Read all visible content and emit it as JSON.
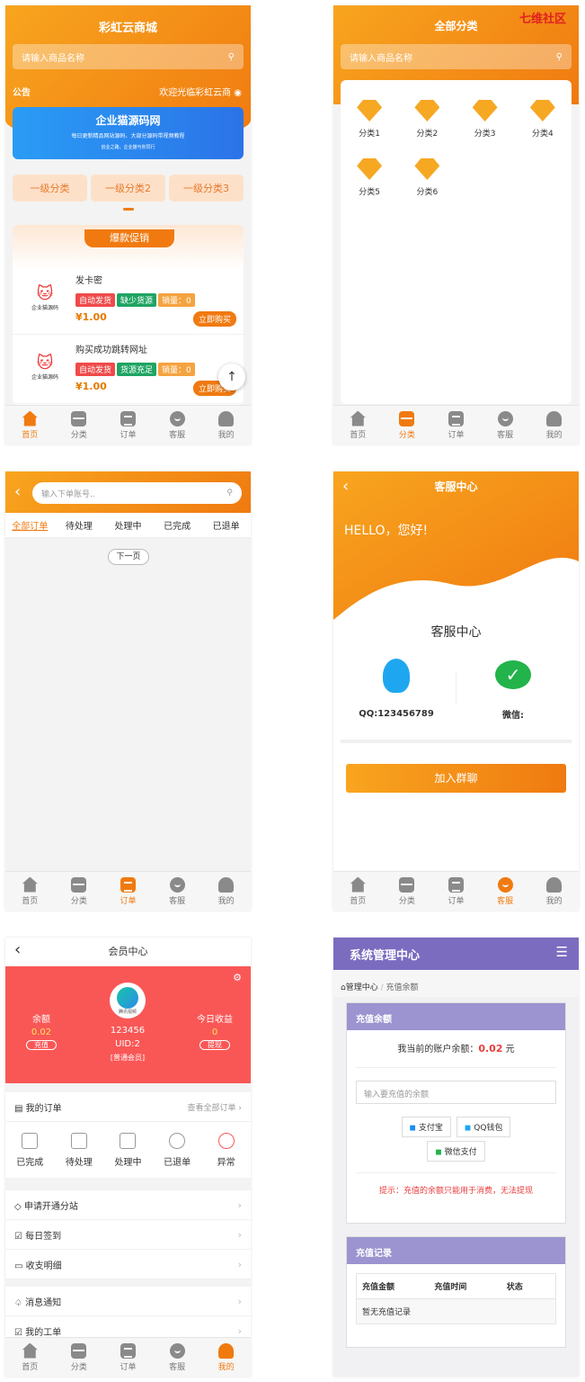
{
  "shop": {
    "title": "彩虹云商城",
    "search_placeholder": "请输入商品名称",
    "notice_label": "公告",
    "welcome": "欢迎光临彩虹云商",
    "banner_title": "企业猫源码网",
    "banner_sub": "每日更新精品网站源码、大部分源码带视频教程",
    "banner_sub2": "创业之路，企业猫与你同行",
    "subcats": [
      "一级分类",
      "一级分类2",
      "一级分类3"
    ],
    "hot_title": "爆款促销",
    "logo_text": "企业猫源码",
    "products": [
      {
        "name": "发卡密",
        "tags": [
          "自动发货",
          "缺少货源",
          "销量：0"
        ],
        "price": "¥1.00",
        "buy": "立即购买"
      },
      {
        "name": "购买成功跳转网址",
        "tags": [
          "自动发货",
          "货源充足",
          "销量：0"
        ],
        "price": "¥1.00",
        "buy": "立即购买"
      }
    ],
    "back_top": "↑"
  },
  "categories": {
    "title": "全部分类",
    "watermark": "七维社区",
    "search_placeholder": "请输入商品名称",
    "items": [
      "分类1",
      "分类2",
      "分类3",
      "分类4",
      "分类5",
      "分类6"
    ]
  },
  "orders": {
    "search_placeholder": "输入下单账号..",
    "back": "‹",
    "tabs": [
      "全部订单",
      "待处理",
      "处理中",
      "已完成",
      "已退单"
    ],
    "next": "下一页"
  },
  "service": {
    "title": "客服中心",
    "back": "‹",
    "hello": "HELLO，您好!",
    "section": "客服中心",
    "qq": "QQ:123456789",
    "wechat": "微信:",
    "join": "加入群聊"
  },
  "member": {
    "title": "会员中心",
    "back": "‹",
    "balance_label": "余额",
    "balance": "0.02",
    "recharge": "充值",
    "avatar_text": "腾讯视频",
    "username": "123456",
    "uid": "UID:2",
    "level": "[普通会员]",
    "today_label": "今日收益",
    "today": "0",
    "withdraw": "提现",
    "my_orders": "我的订单",
    "all_orders": "查看全部订单 ›",
    "order_states": [
      "已完成",
      "待处理",
      "处理中",
      "已退单",
      "异常"
    ],
    "menu1": [
      "申请开通分站",
      "每日签到",
      "收支明细"
    ],
    "menu2": [
      "消息通知",
      "我的工单"
    ]
  },
  "admin": {
    "title": "系统管理中心",
    "menu": "☰",
    "crumb1": "管理中心",
    "crumb2": "充值余额",
    "panel1": "充值余额",
    "balance_text": "我当前的账户余额：",
    "balance_value": "0.02",
    "balance_unit": "元",
    "input_placeholder": "输入要充值的余额",
    "pay_alipay": "支付宝",
    "pay_qq": "QQ钱包",
    "pay_wechat": "微信支付",
    "hint": "提示：充值的余额只能用于消费，无法提现",
    "panel2": "充值记录",
    "cols": [
      "充值金额",
      "充值时间",
      "状态"
    ],
    "empty": "暂无充值记录"
  },
  "tabbar": [
    "首页",
    "分类",
    "订单",
    "客服",
    "我的"
  ],
  "colors": {
    "orange": "#f07a10",
    "red": "#f95756",
    "purple": "#7b6cc0",
    "lavender": "#9b94d0"
  }
}
